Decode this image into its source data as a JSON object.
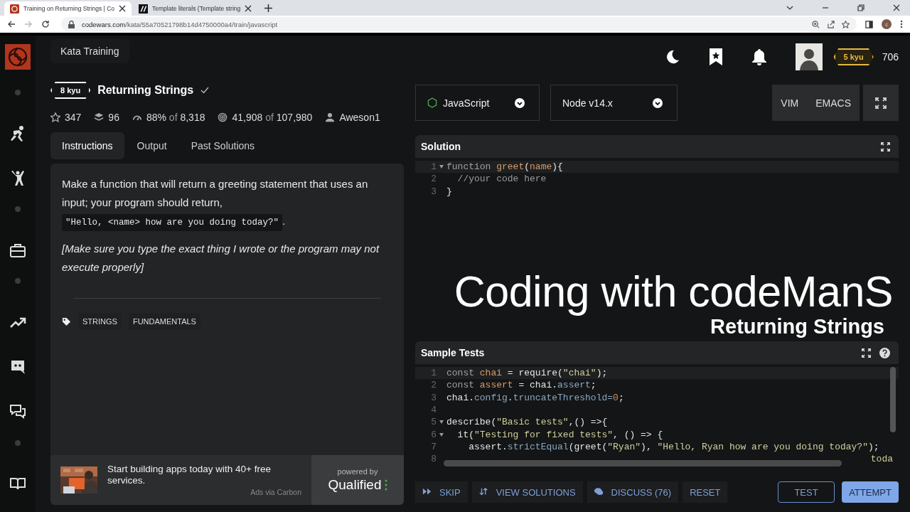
{
  "browser": {
    "tabs": [
      {
        "title": "Training on Returning Strings | Co",
        "selected": true
      },
      {
        "title": "Template literals (Template string",
        "selected": false
      }
    ],
    "forward_disabled": true,
    "url_host": "codewars.com",
    "url_path": "/kata/55a70521798b14d4750000a4/train/javascript",
    "profile_initial": "c"
  },
  "sidebar": {
    "items": [
      {
        "kind": "logo"
      },
      {
        "kind": "dot"
      },
      {
        "kind": "runner"
      },
      {
        "kind": "fighter"
      },
      {
        "kind": "dot"
      },
      {
        "kind": "briefcase"
      },
      {
        "kind": "dot"
      },
      {
        "kind": "trend"
      },
      {
        "kind": "discord"
      },
      {
        "kind": "chat"
      },
      {
        "kind": "dot"
      },
      {
        "kind": "book"
      }
    ]
  },
  "header": {
    "section": "Kata Training",
    "rank": "5 kyu",
    "honor": "706"
  },
  "kata": {
    "rank": "8 kyu",
    "title": "Returning Strings",
    "completed": true,
    "stats": [
      {
        "parts": [
          "347"
        ]
      },
      {
        "parts": [
          "96"
        ]
      },
      {
        "parts": [
          "88%",
          "of",
          "8,318"
        ]
      },
      {
        "parts": [
          "41,908",
          "of",
          "107,980"
        ]
      },
      {
        "parts": [
          "Aweson1"
        ]
      }
    ]
  },
  "tabs": [
    {
      "label": "Instructions",
      "selected": true
    },
    {
      "label": "Output",
      "selected": false
    },
    {
      "label": "Past Solutions",
      "selected": false
    }
  ],
  "description": [
    {
      "kind": "text",
      "text": "Make a function that will return a greeting statement that uses an input; your program should return,",
      "code": "\"Hello, <name> how are you doing today?\"",
      "after": "."
    },
    {
      "kind": "italic",
      "text": "[Make sure you type the exact thing I wrote or the program may not execute properly]"
    }
  ],
  "tags": [
    "STRINGS",
    "FUNDAMENTALS"
  ],
  "ad": {
    "text": "Start building apps today with 40+ free services.",
    "via": "Ads via Carbon",
    "powered_by": "powered by",
    "brand": "Qualified"
  },
  "editor": {
    "language": "JavaScript",
    "version": "Node v14.x",
    "modes": [
      "VIM",
      "EMACS"
    ]
  },
  "solution": {
    "title": "Solution",
    "lines": [
      {
        "number": "1",
        "fold": true,
        "highlighted": true,
        "tokens": [
          {
            "text": "function ",
            "kind": "keyword"
          },
          {
            "text": "greet",
            "kind": "name"
          },
          {
            "text": "(",
            "kind": "plain"
          },
          {
            "text": "name",
            "kind": "name"
          },
          {
            "text": "){",
            "kind": "plain"
          }
        ]
      },
      {
        "number": "2",
        "fold": false,
        "highlighted": false,
        "tokens": [
          {
            "text": "  //your code here",
            "kind": "comment"
          }
        ]
      },
      {
        "number": "3",
        "fold": false,
        "highlighted": false,
        "tokens": [
          {
            "text": "}",
            "kind": "plain"
          }
        ]
      }
    ]
  },
  "overlay": {
    "title": "Coding with codeManS",
    "subtitle": "Returning Strings"
  },
  "tests": {
    "title": "Sample Tests",
    "lines": [
      {
        "number": "1",
        "fold": false,
        "highlighted": true,
        "tokens": [
          {
            "text": "const ",
            "kind": "keyword"
          },
          {
            "text": "chai",
            "kind": "name"
          },
          {
            "text": " = require(",
            "kind": "plain"
          },
          {
            "text": "\"chai\"",
            "kind": "string"
          },
          {
            "text": ");",
            "kind": "plain"
          }
        ]
      },
      {
        "number": "2",
        "fold": false,
        "highlighted": false,
        "tokens": [
          {
            "text": "const ",
            "kind": "keyword"
          },
          {
            "text": "assert",
            "kind": "name"
          },
          {
            "text": " = chai.",
            "kind": "plain"
          },
          {
            "text": "assert",
            "kind": "prop"
          },
          {
            "text": ";",
            "kind": "plain"
          }
        ]
      },
      {
        "number": "3",
        "fold": false,
        "highlighted": false,
        "tokens": [
          {
            "text": "chai.",
            "kind": "plain"
          },
          {
            "text": "config",
            "kind": "prop"
          },
          {
            "text": ".",
            "kind": "plain"
          },
          {
            "text": "truncateThreshold=",
            "kind": "prop"
          },
          {
            "text": "0",
            "kind": "number"
          },
          {
            "text": ";",
            "kind": "plain"
          }
        ]
      },
      {
        "number": "4",
        "fold": false,
        "highlighted": false
      },
      {
        "number": "5",
        "fold": true,
        "highlighted": false,
        "tokens": [
          {
            "text": "describe(",
            "kind": "plain"
          },
          {
            "text": "\"Basic tests\"",
            "kind": "string"
          },
          {
            "text": ",() =>{",
            "kind": "plain"
          }
        ]
      },
      {
        "number": "6",
        "fold": true,
        "highlighted": false,
        "tokens": [
          {
            "text": "  it(",
            "kind": "plain"
          },
          {
            "text": "\"Testing for fixed tests\"",
            "kind": "string"
          },
          {
            "text": ", () => {",
            "kind": "plain"
          }
        ]
      },
      {
        "number": "7",
        "fold": false,
        "highlighted": false,
        "tokens": [
          {
            "text": "    assert.",
            "kind": "plain"
          },
          {
            "text": "strictEqual",
            "kind": "prop"
          },
          {
            "text": "(greet(",
            "kind": "plain"
          },
          {
            "text": "\"Ryan\"",
            "kind": "string"
          },
          {
            "text": "), ",
            "kind": "plain"
          },
          {
            "text": "\"Hello, Ryan how are you doing today?\"",
            "kind": "string"
          },
          {
            "text": ");",
            "kind": "plain"
          }
        ]
      },
      {
        "number": "8",
        "fold": false,
        "highlighted": false,
        "tail": "toda"
      }
    ]
  },
  "actions": [
    {
      "label": "SKIP"
    },
    {
      "label": "VIEW SOLUTIONS"
    },
    {
      "label": "DISCUSS (76)"
    },
    {
      "label": "RESET"
    }
  ],
  "submit": [
    {
      "label": "TEST",
      "kind": "outline"
    },
    {
      "label": "ATTEMPT",
      "kind": "primary"
    }
  ]
}
